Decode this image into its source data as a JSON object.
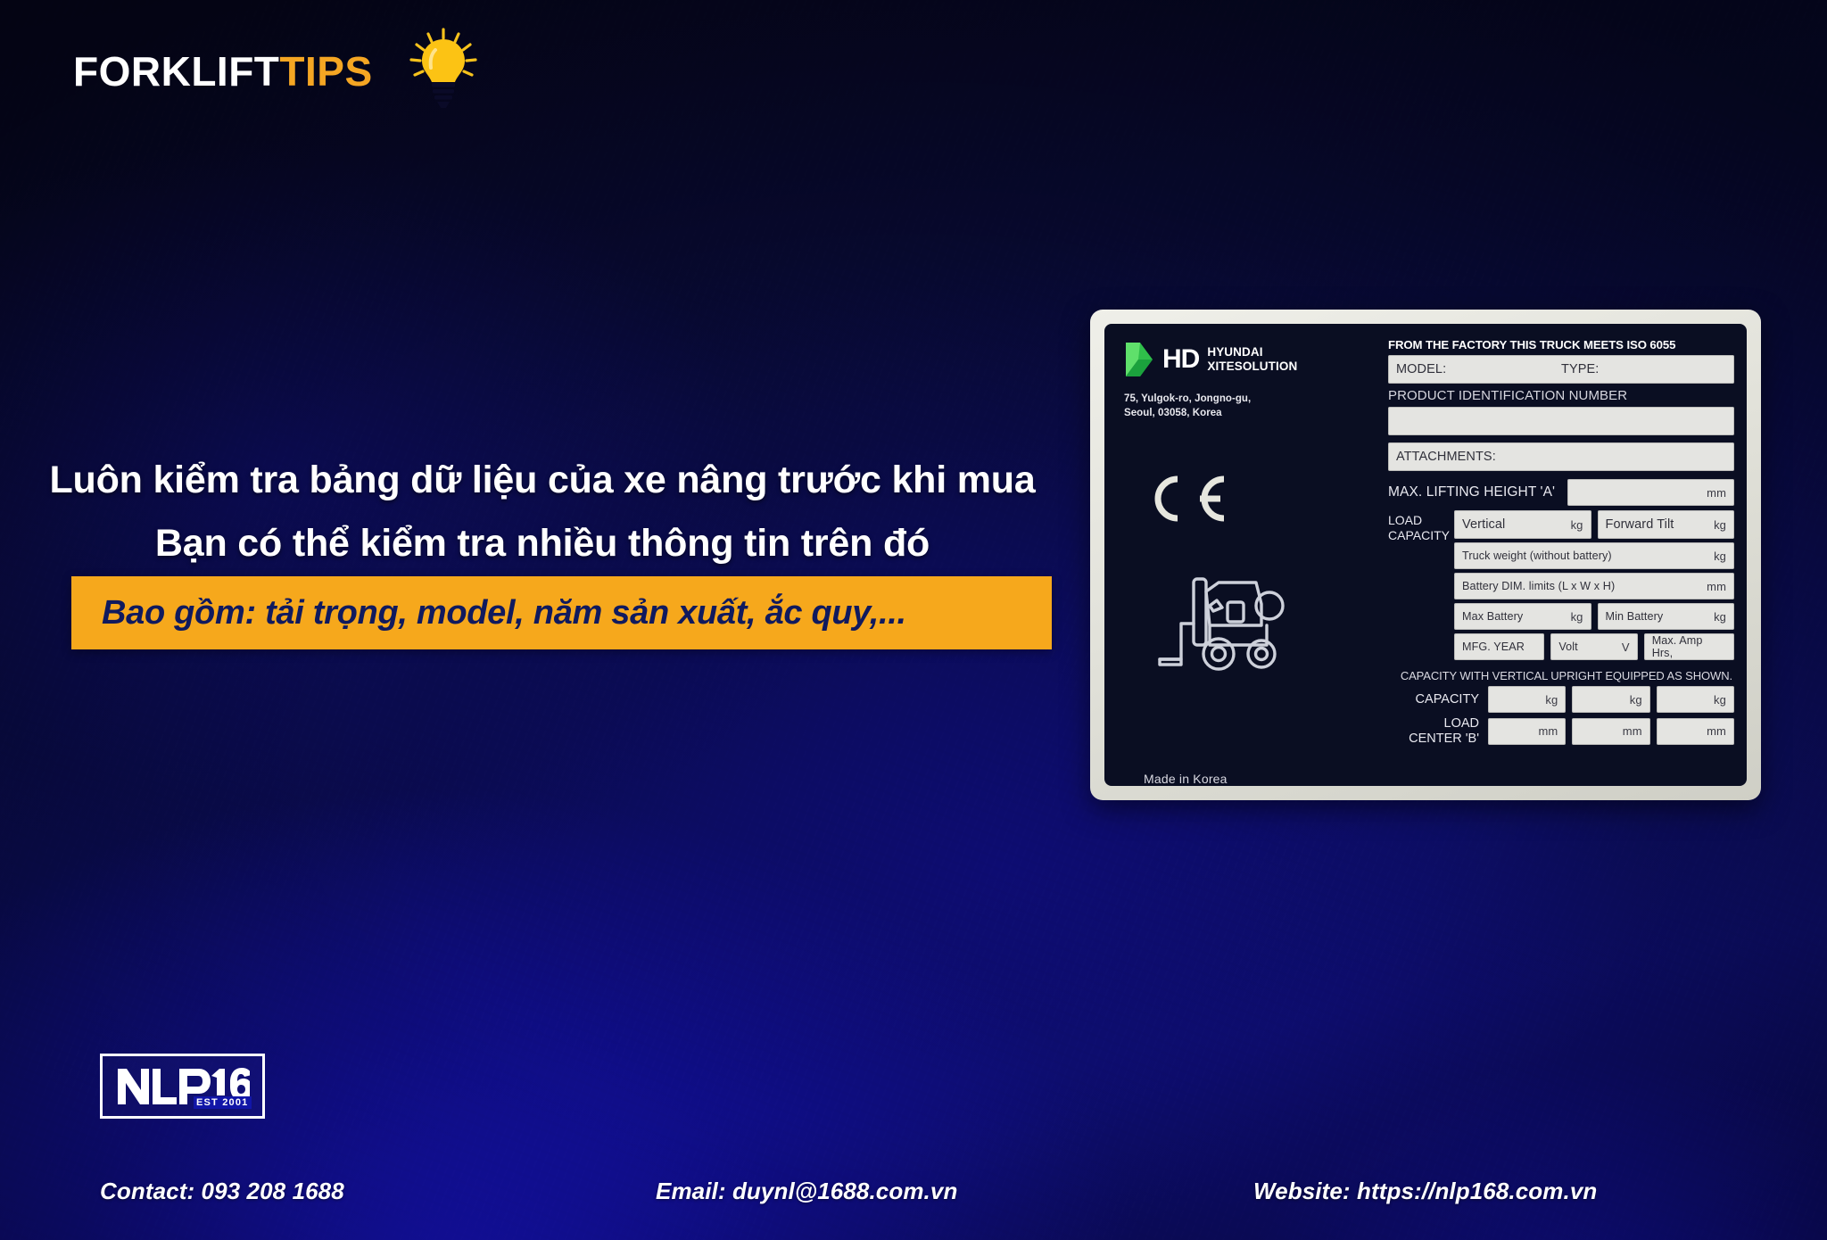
{
  "brand": {
    "word_part1": "FORKLIFT",
    "word_part2": "TIPS",
    "icon": "lightbulb-icon",
    "accent_color": "#f5a623"
  },
  "headline": {
    "line1": "Luôn kiểm tra bảng dữ liệu của xe nâng trước khi mua",
    "line2": "Bạn có thể kiểm tra nhiều thông tin trên đó",
    "highlight": "Bao gồm: tải trọng, model, năm sản xuất, ắc quy,...",
    "highlight_bg": "#f6a81c",
    "highlight_text_color": "#101a5e"
  },
  "nameplate": {
    "brand_mark": "HD",
    "brand_name_line1": "HYUNDAI",
    "brand_name_line2": "XITESOLUTION",
    "logo_icon": "hd-chevron-icon",
    "address_line1": "75, Yulgok-ro, Jongno-gu,",
    "address_line2": "Seoul, 03058, Korea",
    "ce_mark": "ce-mark-icon",
    "forklift_icon": "forklift-icon",
    "made_in": "Made in Korea",
    "iso_header": "FROM THE FACTORY THIS TRUCK MEETS ISO 6055",
    "model_label": "MODEL:",
    "type_label": "TYPE:",
    "pin_label": "PRODUCT IDENTIFICATION NUMBER",
    "pin_value": "",
    "attachments_label": "ATTACHMENTS:",
    "max_lifting_height_label": "MAX. LIFTING HEIGHT 'A'",
    "max_lifting_height_unit": "mm",
    "load_capacity_label_line1": "LOAD",
    "load_capacity_label_line2": "CAPACITY",
    "vertical_label": "Vertical",
    "vertical_unit": "kg",
    "forward_tilt_label": "Forward Tilt",
    "forward_tilt_unit": "kg",
    "truck_weight_label": "Truck weight (without battery)",
    "truck_weight_unit": "kg",
    "battery_dim_label": "Battery DIM. limits (L x W x H)",
    "battery_dim_unit": "mm",
    "max_battery_label": "Max Battery",
    "max_battery_unit": "kg",
    "min_battery_label": "Min Battery",
    "min_battery_unit": "kg",
    "mfg_year_label": "MFG. YEAR",
    "volt_label": "Volt",
    "volt_unit": "V",
    "max_amp_hrs_label": "Max. Amp Hrs,",
    "capacity_section_title": "CAPACITY WITH VERTICAL UPRIGHT EQUIPPED AS SHOWN.",
    "capacity_row_label": "CAPACITY",
    "capacity_units": [
      "kg",
      "kg",
      "kg"
    ],
    "load_center_label_line1": "LOAD",
    "load_center_label_line2": "CENTER  'B'",
    "load_center_units": [
      "mm",
      "mm",
      "mm"
    ]
  },
  "company_logo": {
    "name": "NLP168",
    "established": "EST 2001"
  },
  "footer": {
    "contact": "Contact: 093 208 1688",
    "email": "Email: duynl@1688.com.vn",
    "website": "Website: https://nlp168.com.vn"
  }
}
